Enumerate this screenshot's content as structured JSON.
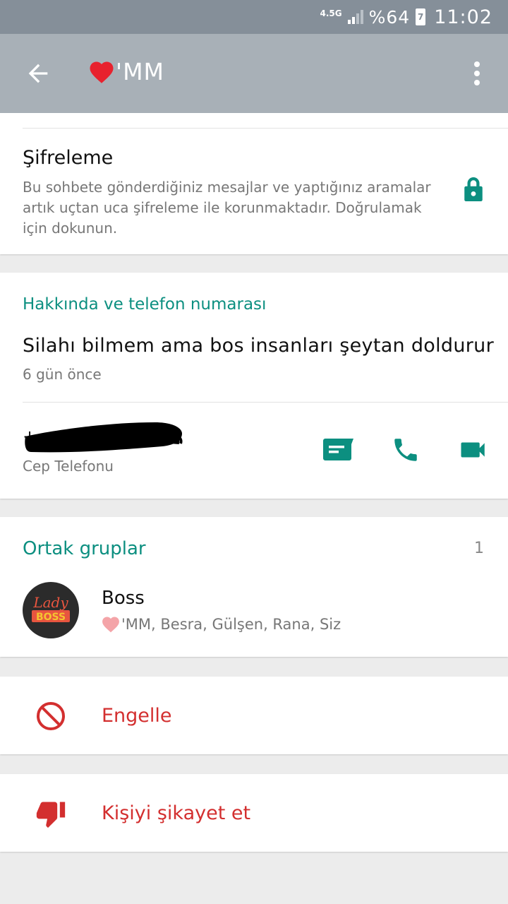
{
  "status_bar": {
    "network": "4.5G",
    "battery_percent": "%64",
    "battery_glyph": "7",
    "time": "11:02"
  },
  "app_bar": {
    "contact_name": "'MM",
    "back_icon": "arrow-left-icon",
    "menu_icon": "more-vert-icon"
  },
  "encryption": {
    "title": "Şifreleme",
    "description": "Bu sohbete gönderdiğiniz mesajlar ve yaptığınız aramalar artık uçtan uca şifreleme ile korunmaktadır. Doğrulamak için dokunun.",
    "icon": "lock-icon"
  },
  "about": {
    "section_title": "Hakkında ve telefon numarası",
    "status_text": "Silahı bilmem ama bos insanları şeytan doldurur",
    "status_time": "6 gün önce",
    "phone_number": "+",
    "phone_type": "Cep Telefonu",
    "actions": [
      "message-icon",
      "phone-icon",
      "video-call-icon"
    ]
  },
  "groups": {
    "section_title": "Ortak gruplar",
    "count": "1",
    "items": [
      {
        "name": "Boss",
        "members": "'MM, Besra, Gülşen, Rana, Siz",
        "avatar_text_top": "Lady",
        "avatar_text_bottom": "BOSS"
      }
    ]
  },
  "actions": {
    "block_label": "Engelle",
    "report_label": "Kişiyi şikayet et"
  },
  "colors": {
    "accent": "#0c8f80",
    "danger": "#d32f2f",
    "app_bar": "#a8b0b7",
    "status_bar": "#858f99",
    "heart": "#e8222e"
  }
}
